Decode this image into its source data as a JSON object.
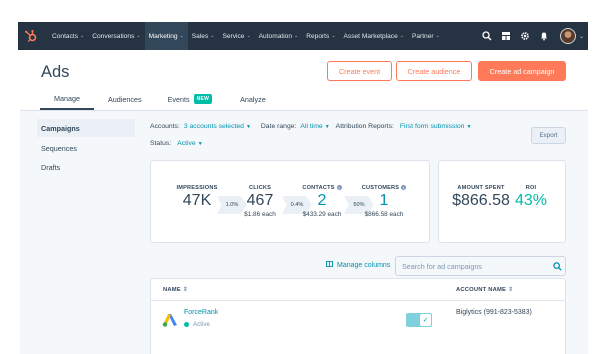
{
  "nav": {
    "logo": "hubspot-logo",
    "items": [
      {
        "label": "Contacts"
      },
      {
        "label": "Conversations"
      },
      {
        "label": "Marketing"
      },
      {
        "label": "Sales"
      },
      {
        "label": "Service"
      },
      {
        "label": "Automation"
      },
      {
        "label": "Reports"
      },
      {
        "label": "Asset Marketplace"
      },
      {
        "label": "Partner"
      }
    ],
    "active_item": "Marketing",
    "icons": [
      "search-icon",
      "marketplace-icon",
      "settings-icon",
      "notifications-icon"
    ]
  },
  "header": {
    "title": "Ads",
    "buttons": {
      "create_event": "Create event",
      "create_audience": "Create audience",
      "create_campaign": "Create ad campaign"
    }
  },
  "tabs": [
    {
      "label": "Manage"
    },
    {
      "label": "Audiences"
    },
    {
      "label": "Events",
      "badge": "NEW"
    },
    {
      "label": "Analyze"
    }
  ],
  "sidebar": {
    "items": [
      {
        "label": "Campaigns"
      },
      {
        "label": "Sequences"
      },
      {
        "label": "Drafts"
      }
    ]
  },
  "filters": {
    "accounts_label": "Accounts:",
    "accounts_value": "3 accounts selected",
    "date_label": "Date range:",
    "date_value": "All time",
    "attribution_label": "Attribution Reports:",
    "attribution_value": "First form submission",
    "status_label": "Status:",
    "status_value": "Active",
    "export": "Export"
  },
  "funnel": {
    "impressions": {
      "label": "IMPRESSIONS",
      "value": "47K"
    },
    "rate1": "1.0%",
    "clicks": {
      "label": "CLICKS",
      "value": "467",
      "sub": "$1.86 each"
    },
    "rate2": "0.4%",
    "contacts": {
      "label": "CONTACTS",
      "value": "2",
      "sub": "$433.29 each"
    },
    "rate3": "50%",
    "customers": {
      "label": "CUSTOMERS",
      "value": "1",
      "sub": "$866.58 each"
    }
  },
  "spend": {
    "amount": {
      "label": "AMOUNT SPENT",
      "value": "$866.58"
    },
    "roi": {
      "label": "ROI",
      "value": "43%"
    }
  },
  "table_tools": {
    "manage_columns": "Manage columns",
    "search_placeholder": "Search for ad campaigns"
  },
  "table": {
    "columns": [
      "NAME",
      "ACCOUNT NAME"
    ],
    "rows": [
      {
        "name": "ForceRank",
        "status": "Active",
        "account": "Biglytics (991-823-5383)"
      }
    ]
  }
}
